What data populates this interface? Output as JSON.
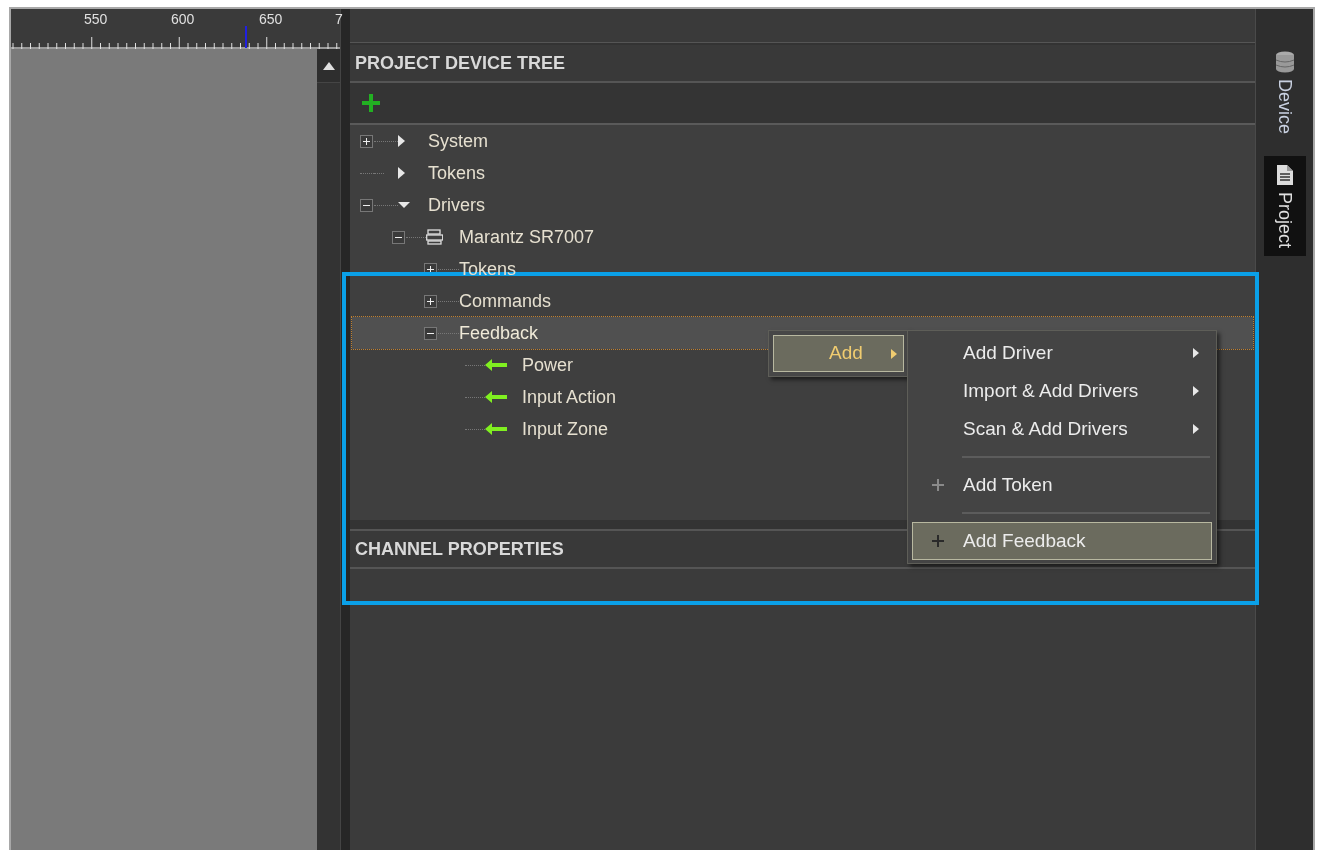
{
  "ruler": {
    "labels": [
      "550",
      "600",
      "650",
      "7"
    ]
  },
  "device_tree": {
    "title": "PROJECT DEVICE TREE",
    "nodes": [
      {
        "kind": "category",
        "label": "System",
        "expander": true,
        "expanded": false,
        "selected": false
      },
      {
        "kind": "category",
        "label": "Tokens",
        "expander": false,
        "expanded": false,
        "selected": false
      },
      {
        "kind": "category",
        "label": "Drivers",
        "expander": true,
        "expanded": true,
        "selected": false,
        "children": [
          {
            "kind": "device",
            "label": "Marantz SR7007",
            "expander": true,
            "expanded": true,
            "selected": false,
            "children": [
              {
                "kind": "folder",
                "label": "Tokens",
                "expander": true,
                "expanded": false,
                "selected": false
              },
              {
                "kind": "folder",
                "label": "Commands",
                "expander": true,
                "expanded": false,
                "selected": false
              },
              {
                "kind": "folder",
                "label": "Feedback",
                "expander": true,
                "expanded": true,
                "selected": true,
                "children": [
                  {
                    "kind": "feedback",
                    "label": "Power",
                    "selected": false
                  },
                  {
                    "kind": "feedback",
                    "label": "Input Action",
                    "selected": false
                  },
                  {
                    "kind": "feedback",
                    "label": "Input Zone",
                    "selected": false
                  }
                ]
              }
            ]
          }
        ]
      }
    ]
  },
  "channel_properties": {
    "title": "CHANNEL PROPERTIES"
  },
  "context_menu": {
    "items": [
      {
        "label": "Add",
        "selected": true,
        "submenu": true
      }
    ]
  },
  "submenu": {
    "items": [
      {
        "kind": "item",
        "label": "Add Driver",
        "submenu": true,
        "selected": false
      },
      {
        "kind": "item",
        "label": "Import & Add Drivers",
        "submenu": true,
        "selected": false
      },
      {
        "kind": "item",
        "label": "Scan & Add Drivers",
        "submenu": true,
        "selected": false
      },
      {
        "kind": "separator"
      },
      {
        "kind": "item",
        "label": "Add Token",
        "submenu": false,
        "selected": false
      },
      {
        "kind": "separator"
      },
      {
        "kind": "item",
        "label": "Add Feedback",
        "submenu": false,
        "selected": true
      }
    ]
  },
  "side_tabs": [
    {
      "label": "Device",
      "selected": false
    },
    {
      "label": "Project",
      "selected": true
    }
  ]
}
